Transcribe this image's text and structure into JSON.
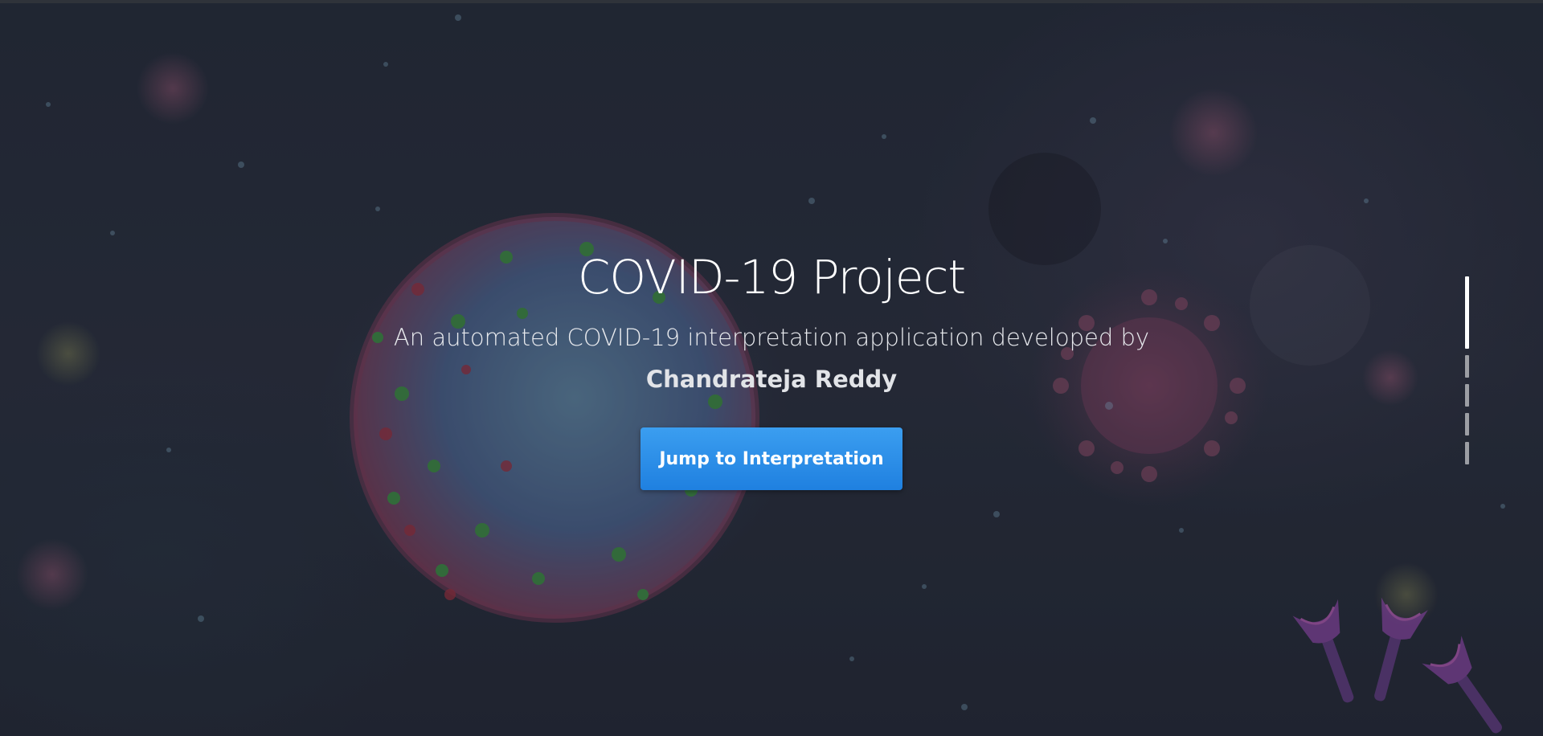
{
  "hero": {
    "title": "COVID-19 Project",
    "subtitle": "An automated COVID-19 interpretation application developed by",
    "author": "Chandrateja Reddy",
    "cta_label": "Jump to Interpretation",
    "background_image": "coronavirus-illustration"
  },
  "scroll_nav": {
    "sections": [
      "section-1",
      "section-2",
      "section-3",
      "section-4",
      "section-5"
    ],
    "active_index": 0
  },
  "colors": {
    "accent": "#2a8ce8",
    "background": "#252b3a",
    "text": "#ffffff"
  }
}
